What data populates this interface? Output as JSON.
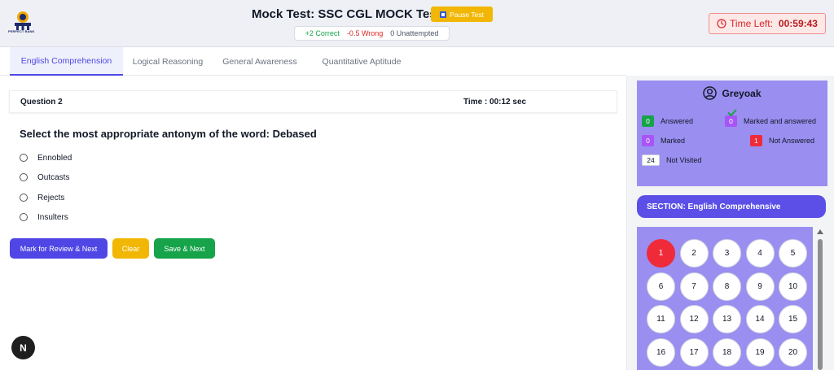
{
  "header": {
    "logo_text": "PERFECT BANK",
    "title": "Mock Test: SSC CGL MOCK Test 02",
    "pause_label": "Pause Test",
    "score": {
      "correct": "+2 Correct",
      "wrong": "-0.5 Wrong",
      "unattempted": "0 Unattempted"
    },
    "timer": {
      "label": "Time Left:",
      "value": "00:59:43"
    }
  },
  "tabs": [
    {
      "label": "English Comprehension",
      "active": true
    },
    {
      "label": "Logical Reasoning",
      "active": false
    },
    {
      "label": "General Awareness",
      "active": false
    },
    {
      "label": "Quantitative Aptitude",
      "active": false
    }
  ],
  "question": {
    "number_label": "Question 2",
    "time_label": "Time : 00:12 sec",
    "text": "Select the most appropriate antonym of the word: Debased",
    "options": [
      "Ennobled",
      "Outcasts",
      "Rejects",
      "Insulters"
    ]
  },
  "actions": {
    "review_label": "Mark for Review & Next",
    "clear_label": "Clear",
    "save_label": "Save & Next"
  },
  "fab_label": "N",
  "panel": {
    "username": "Greyoak",
    "legend": {
      "answered": {
        "count": "0",
        "label": "Answered"
      },
      "marked_answered": {
        "count": "0",
        "label": "Marked and answered"
      },
      "marked": {
        "count": "0",
        "label": "Marked"
      },
      "not_answered": {
        "count": "1",
        "label": "Not Answered"
      },
      "not_visited": {
        "count": "24",
        "label": "Not Visited"
      }
    },
    "section_label": "SECTION: English Comprehensive",
    "question_numbers": [
      "1",
      "2",
      "3",
      "4",
      "5",
      "6",
      "7",
      "8",
      "9",
      "10",
      "11",
      "12",
      "13",
      "14",
      "15",
      "16",
      "17",
      "18",
      "19",
      "20"
    ],
    "current_question": "1"
  },
  "colors": {
    "accent": "#4f46e5",
    "panel": "#9a8ef0",
    "correct": "#16a34a",
    "wrong": "#dc2626",
    "warning": "#f2b705"
  }
}
